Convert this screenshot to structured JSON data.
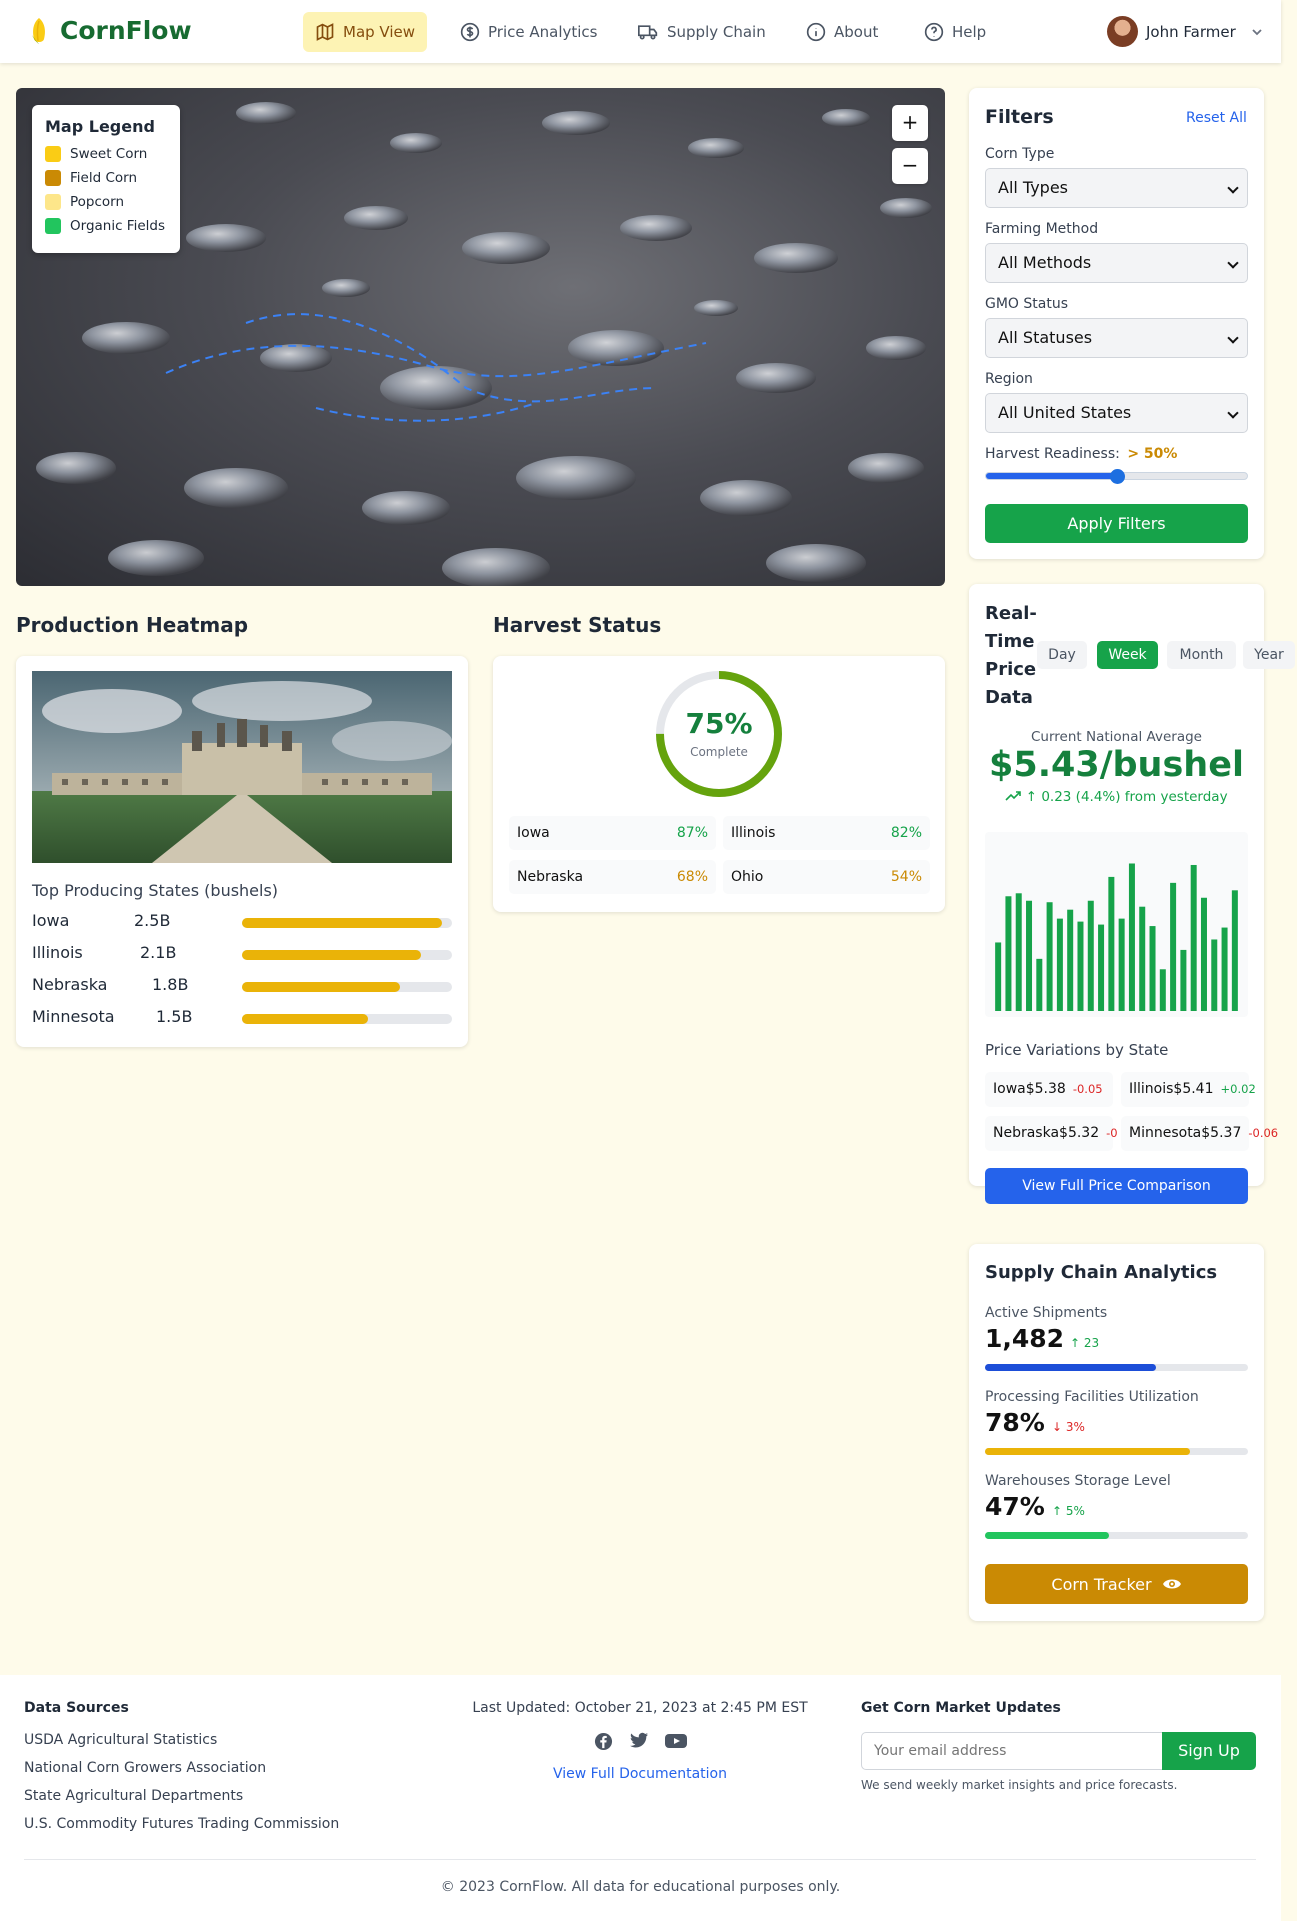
{
  "nav": {
    "brand": "CornFlow",
    "items": [
      {
        "label": "Map View",
        "icon": "map-icon"
      },
      {
        "label": "Price Analytics",
        "icon": "dollar-icon"
      },
      {
        "label": "Supply Chain",
        "icon": "truck-icon"
      },
      {
        "label": "About",
        "icon": "info-icon"
      },
      {
        "label": "Help",
        "icon": "help-icon"
      }
    ],
    "user": "John Farmer"
  },
  "map": {
    "legend_title": "Map Legend",
    "legend": [
      {
        "label": "Sweet Corn",
        "color": "#facc15"
      },
      {
        "label": "Field Corn",
        "color": "#ca8a04"
      },
      {
        "label": "Popcorn",
        "color": "#fde68a"
      },
      {
        "label": "Organic Fields",
        "color": "#22c55e"
      }
    ],
    "zoom_in": "+",
    "zoom_out": "−"
  },
  "production": {
    "title": "Production Heatmap",
    "states_label": "Top Producing States (bushels)",
    "states": [
      {
        "name": "Iowa",
        "value": "2.5B",
        "percent": 95
      },
      {
        "name": "Illinois",
        "value": "2.1B",
        "percent": 85
      },
      {
        "name": "Nebraska",
        "value": "1.8B",
        "percent": 75
      },
      {
        "name": "Minnesota",
        "value": "1.5B",
        "percent": 60
      }
    ]
  },
  "harvest": {
    "title": "Harvest Status",
    "percent": "75%",
    "percent_value": 75,
    "complete_label": "Complete",
    "states": [
      {
        "name": "Iowa",
        "percent": "87%",
        "color": "#16a34a"
      },
      {
        "name": "Illinois",
        "percent": "82%",
        "color": "#16a34a"
      },
      {
        "name": "Nebraska",
        "percent": "68%",
        "color": "#ca8a04"
      },
      {
        "name": "Ohio",
        "percent": "54%",
        "color": "#ca8a04"
      }
    ]
  },
  "filters": {
    "title": "Filters",
    "reset": "Reset All",
    "fields": [
      {
        "label": "Corn Type",
        "value": "All Types"
      },
      {
        "label": "Farming Method",
        "value": "All Methods"
      },
      {
        "label": "GMO Status",
        "value": "All Statuses"
      },
      {
        "label": "Region",
        "value": "All United States"
      }
    ],
    "readiness_label": "Harvest Readiness:",
    "readiness_value": "> 50%",
    "readiness_level": 50,
    "apply": "Apply Filters"
  },
  "price": {
    "title_lines": [
      "Real-",
      "Time",
      "Price",
      "Data"
    ],
    "tabs": [
      "Day",
      "Week",
      "Month",
      "Year"
    ],
    "active_tab": "Week",
    "avg_label": "Current National Average",
    "avg_value": "$5.43/bushel",
    "change": "↑ 0.23 (4.4%) from yesterday",
    "variations_title": "Price Variations by State",
    "variations": [
      {
        "name": "Iowa",
        "price": "$5.38",
        "change": "-0.05",
        "color": "#dc2626"
      },
      {
        "name": "Illinois",
        "price": "$5.41",
        "change": "+0.02",
        "color": "#16a34a"
      },
      {
        "name": "Nebraska",
        "price": "$5.32",
        "change": "-0",
        "color": "#dc2626"
      },
      {
        "name": "Minnesota",
        "price": "$5.37",
        "change": "-0.06",
        "color": "#dc2626"
      }
    ],
    "compare_button": "View Full Price Comparison"
  },
  "chart_data": {
    "type": "bar",
    "values": [
      46,
      77,
      79,
      74,
      35,
      73,
      62,
      68,
      60,
      74,
      58,
      90,
      62,
      99,
      70,
      57,
      28,
      86,
      41,
      98,
      76,
      48,
      56,
      81
    ],
    "ylim": [
      0,
      100
    ]
  },
  "supply": {
    "title": "Supply Chain Analytics",
    "metrics": [
      {
        "label": "Active Shipments",
        "value": "1,482",
        "change": "↑ 23",
        "change_color": "#16a34a",
        "percent": 65,
        "bar_color": "#1d4ed8"
      },
      {
        "label": "Processing Facilities Utilization",
        "value": "78%",
        "change": "↓ 3%",
        "change_color": "#dc2626",
        "percent": 78,
        "bar_color": "#eab308"
      },
      {
        "label": "Warehouses Storage Level",
        "value": "47%",
        "change": "↑ 5%",
        "change_color": "#16a34a",
        "percent": 47,
        "bar_color": "#22c55e"
      }
    ],
    "tracker_button": "Corn Tracker"
  },
  "footer": {
    "sources_title": "Data Sources",
    "sources": [
      "USDA Agricultural Statistics",
      "National Corn Growers Association",
      "State Agricultural Departments",
      "U.S. Commodity Futures Trading Commission"
    ],
    "updated": "Last Updated: October 21, 2023 at 2:45 PM EST",
    "docs_link": "View Full Documentation",
    "updates_title": "Get Corn Market Updates",
    "email_placeholder": "Your email address",
    "signup": "Sign Up",
    "note": "We send weekly market insights and price forecasts.",
    "copyright": "© 2023 CornFlow. All data for educational purposes only."
  }
}
